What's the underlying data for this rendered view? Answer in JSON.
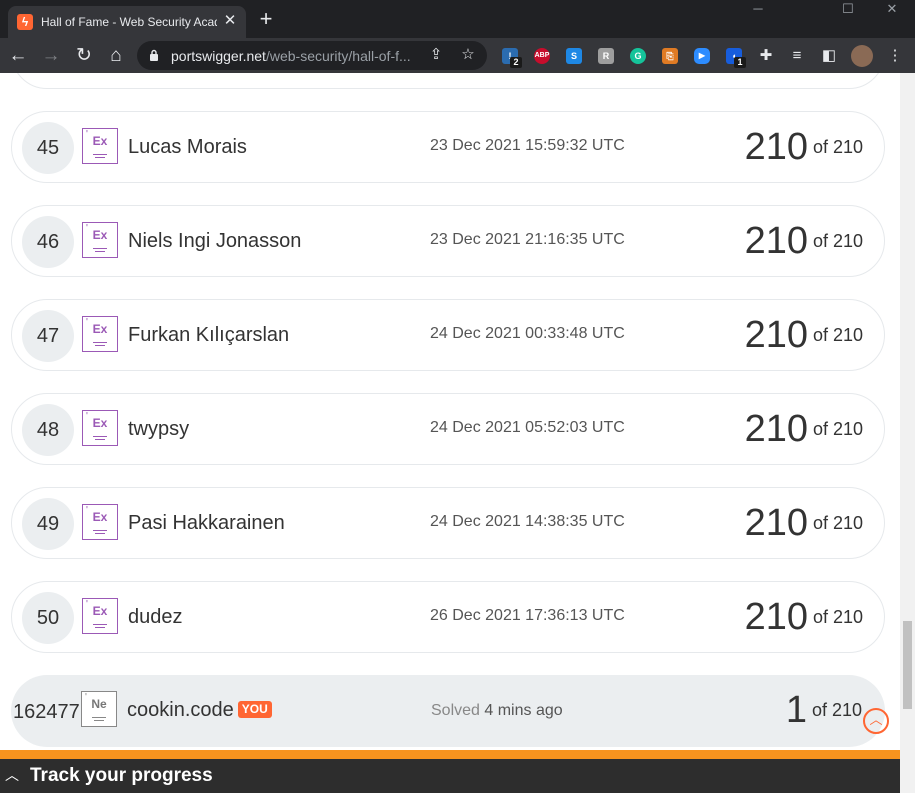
{
  "browser": {
    "tab_title": "Hall of Fame - Web Security Academy",
    "tab_favicon": "portswigger-logo-icon",
    "window_controls": [
      "─",
      "☐",
      "✕"
    ],
    "url_host": "portswigger.net",
    "url_path": "/web-security/hall-of-f...",
    "extensions": [
      {
        "name": "extension-1-icon",
        "label": "!",
        "color": "#2b6cb0",
        "badge": "2"
      },
      {
        "name": "adblock-plus-icon",
        "label": "ABP",
        "color": "#c70d2c"
      },
      {
        "name": "extension-s-icon",
        "label": "S",
        "color": "#1e88e5"
      },
      {
        "name": "extension-r-icon",
        "label": "R",
        "color": "#9e9e9e"
      },
      {
        "name": "grammarly-icon",
        "label": "G",
        "color": "#15c39a"
      },
      {
        "name": "extension-orange-icon",
        "label": "⎘",
        "color": "#e07b24"
      },
      {
        "name": "zoom-icon",
        "label": "▶",
        "color": "#2d8cff"
      },
      {
        "name": "bitwarden-icon",
        "label": "◖",
        "color": "#175ddc",
        "badge": "1"
      }
    ]
  },
  "leaderboard": [
    {
      "rank": "45",
      "badge": "Ex",
      "name": "Lucas Morais",
      "date": "23 Dec 2021 15:59:32 UTC",
      "score": "210",
      "of_total": "of 210"
    },
    {
      "rank": "46",
      "badge": "Ex",
      "name": "Niels Ingi Jonasson",
      "date": "23 Dec 2021 21:16:35 UTC",
      "score": "210",
      "of_total": "of 210"
    },
    {
      "rank": "47",
      "badge": "Ex",
      "name": "Furkan Kılıçarslan",
      "date": "24 Dec 2021 00:33:48 UTC",
      "score": "210",
      "of_total": "of 210"
    },
    {
      "rank": "48",
      "badge": "Ex",
      "name": "twypsy",
      "date": "24 Dec 2021 05:52:03 UTC",
      "score": "210",
      "of_total": "of 210"
    },
    {
      "rank": "49",
      "badge": "Ex",
      "name": "Pasi Hakkarainen",
      "date": "24 Dec 2021 14:38:35 UTC",
      "score": "210",
      "of_total": "of 210"
    },
    {
      "rank": "50",
      "badge": "Ex",
      "name": "dudez",
      "date": "26 Dec 2021 17:36:13 UTC",
      "score": "210",
      "of_total": "of 210"
    }
  ],
  "current_user": {
    "rank": "162477",
    "badge": "Ne",
    "name": "cookin.code",
    "you_label": "YOU",
    "solved_label": "Solved",
    "solved_ago": "4 mins ago",
    "score": "1",
    "of_total": "of 210"
  },
  "progress_panel": {
    "label": "Track your progress"
  },
  "colors": {
    "accent": "#ff6633",
    "badge_expert": "#9b59b6",
    "progress_stripe": "#f7931e"
  }
}
